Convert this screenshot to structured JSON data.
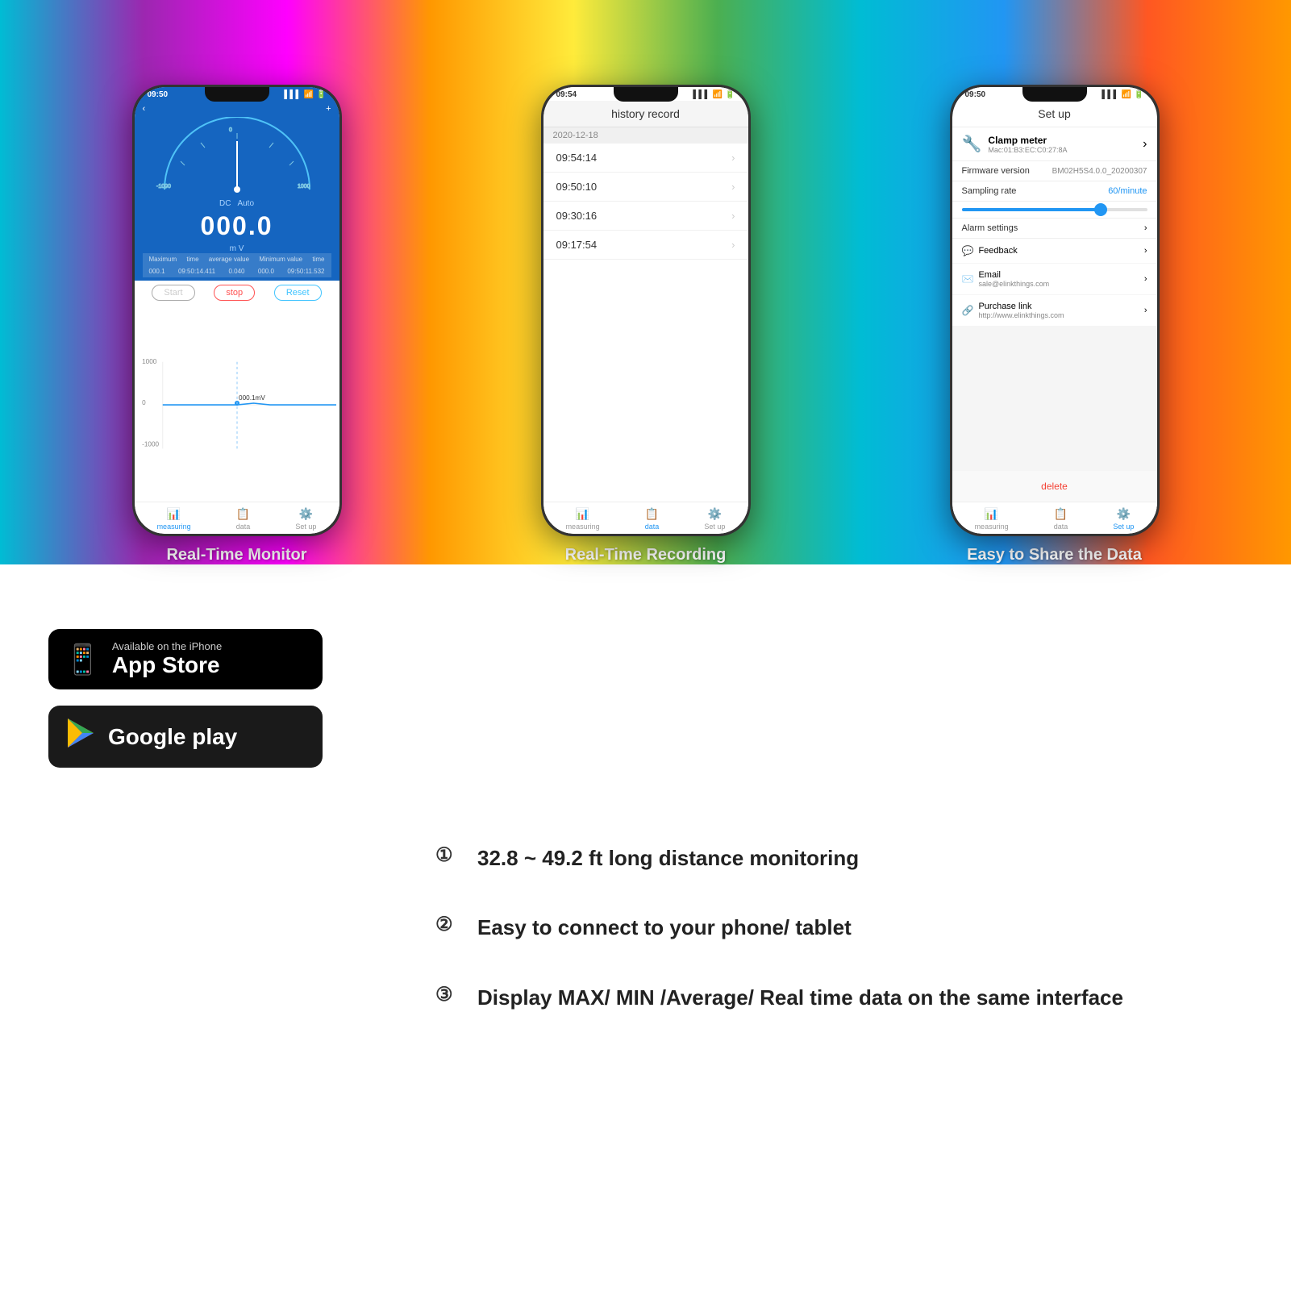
{
  "top_section": {
    "phones": [
      {
        "id": "phone1",
        "caption": "Real-Time Monitor",
        "status_time": "09:50",
        "screen": {
          "back_arrow": "‹",
          "plus": "+",
          "minus": "−",
          "mode": "DC",
          "range": "Auto",
          "value": "000.0",
          "unit": "m V",
          "stats": {
            "maximum_label": "Maximum",
            "max_val": "000.1",
            "time_label": "time",
            "time1_val": "09:50:14.411",
            "avg_label": "average value",
            "avg_val": "0.040",
            "min_label": "Minimum value",
            "min_val": "000.0",
            "time2_label": "time",
            "time2_val": "09:50:11.532"
          },
          "btn_start": "Start",
          "btn_stop": "stop",
          "btn_reset": "Reset",
          "graph_label": "000.1mV",
          "nav": [
            "measuring",
            "data",
            "Set up"
          ]
        }
      },
      {
        "id": "phone2",
        "caption": "Real-Time Recording",
        "status_time": "09:54",
        "screen": {
          "title": "history record",
          "date": "2020-12-18",
          "records": [
            "09:54:14",
            "09:50:10",
            "09:30:16",
            "09:17:54"
          ],
          "nav": [
            "measuring",
            "data",
            "Set up"
          ]
        }
      },
      {
        "id": "phone3",
        "caption": "Easy to Share the Data",
        "status_time": "09:50",
        "screen": {
          "title": "Set up",
          "device_name": "Clamp meter",
          "device_mac": "Mac:01:B3:EC:C0:27:8A",
          "firmware_label": "Firmware version",
          "firmware_value": "BM02H5S4.0.0_20200307",
          "sampling_label": "Sampling rate",
          "sampling_value": "60/minute",
          "alarm_label": "Alarm settings",
          "feedback_label": "Feedback",
          "email_label": "Email",
          "email_value": "sale@elinkthings.com",
          "purchase_label": "Purchase link",
          "purchase_value": "http://www.elinkthings.com",
          "delete_label": "delete",
          "nav": [
            "measuring",
            "data",
            "Set up"
          ]
        }
      }
    ]
  },
  "bottom_section": {
    "app_store": {
      "top_text": "Available on the iPhone",
      "main_text": "App Store"
    },
    "google_play": {
      "main_text": "Google play"
    },
    "features": [
      {
        "number": "①",
        "text": "32.8 ~ 49.2 ft long distance monitoring"
      },
      {
        "number": "②",
        "text": "Easy to connect to your phone/ tablet"
      },
      {
        "number": "③",
        "text": "Display MAX/ MIN /Average/ Real time data on the same interface"
      }
    ]
  }
}
